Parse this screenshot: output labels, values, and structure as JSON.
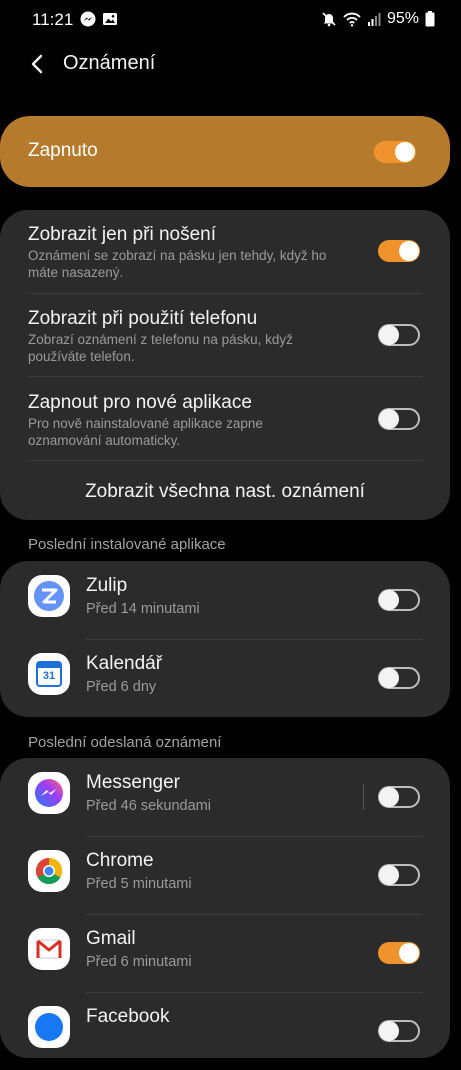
{
  "status": {
    "time": "11:21",
    "battery": "95%"
  },
  "header": {
    "title": "Oznámení"
  },
  "master": {
    "label": "Zapnuto",
    "on": true
  },
  "options": [
    {
      "title": "Zobrazit jen při nošení",
      "desc1": "Oznámení se zobrazí na pásku jen tehdy, když ho",
      "desc2": "máte nasazený.",
      "on": true
    },
    {
      "title": "Zobrazit při použití telefonu",
      "desc1": "Zobrazí oznámení z telefonu na pásku, když",
      "desc2": "používáte telefon.",
      "on": false
    },
    {
      "title": "Zapnout pro nové aplikace",
      "desc1": "Pro nově nainstalované aplikace zapne",
      "desc2": "oznamování automaticky.",
      "on": false
    }
  ],
  "show_all": "Zobrazit všechna nast. oznámení",
  "recent_installed": {
    "header": "Poslední instalované aplikace",
    "apps": [
      {
        "name": "Zulip",
        "sub": "Před 14 minutami",
        "icon": "zulip-icon",
        "on": false
      },
      {
        "name": "Kalendář",
        "sub": "Před 6 dny",
        "icon": "calendar-icon",
        "day": "31",
        "on": false
      }
    ]
  },
  "recent_sent": {
    "header": "Poslední odeslaná oznámení",
    "apps": [
      {
        "name": "Messenger",
        "sub": "Před 46 sekundami",
        "icon": "messenger-icon",
        "on": false
      },
      {
        "name": "Chrome",
        "sub": "Před 5 minutami",
        "icon": "chrome-icon",
        "on": false
      },
      {
        "name": "Gmail",
        "sub": "Před 6 minutami",
        "icon": "gmail-icon",
        "on": true
      },
      {
        "name": "Facebook",
        "sub": "",
        "icon": "facebook-icon",
        "on": false
      }
    ]
  },
  "colors": {
    "accent": "#f1932c",
    "master_bg": "#b67a2c",
    "card_bg": "#2b2b2b"
  }
}
